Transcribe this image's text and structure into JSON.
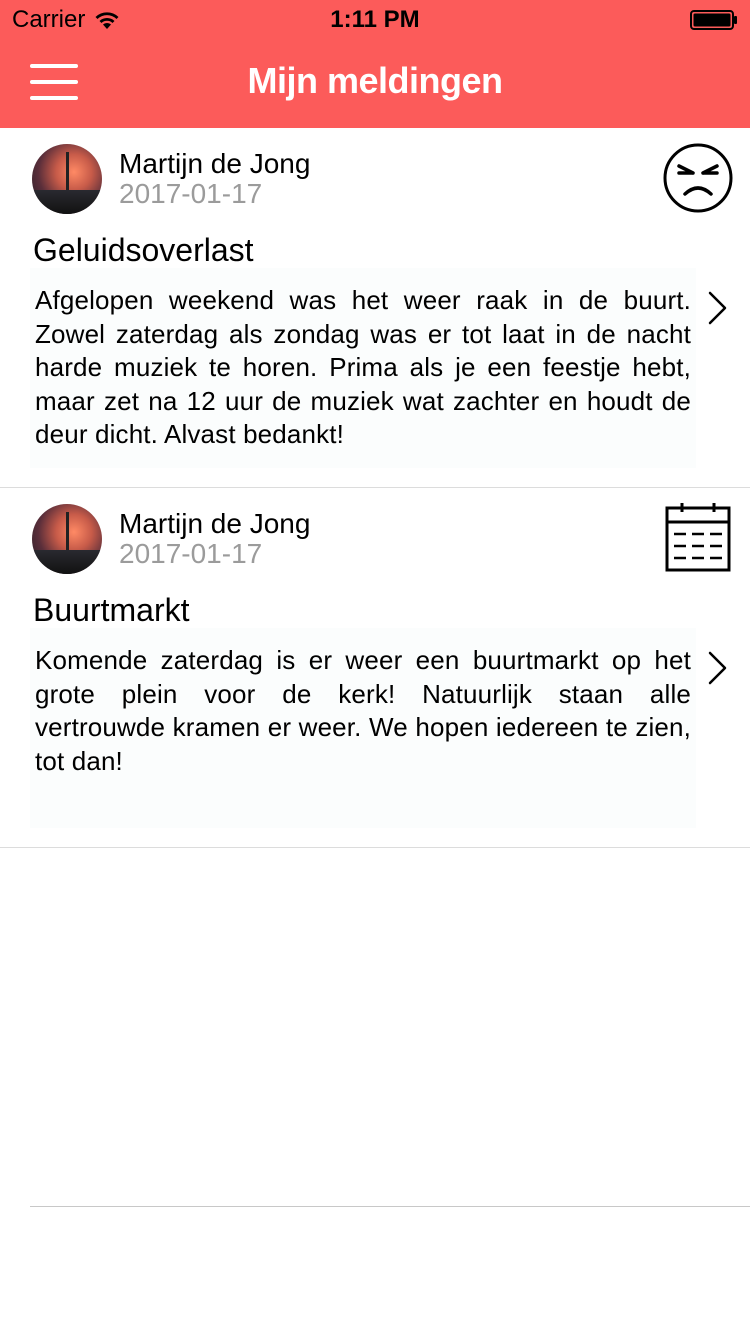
{
  "status_bar": {
    "carrier": "Carrier",
    "time": "1:11 PM",
    "wifi_icon": "wifi-icon",
    "battery_icon": "battery-icon"
  },
  "nav": {
    "title": "Mijn meldingen",
    "menu_icon": "hamburger-menu-icon",
    "background_color": "#fc5b5a",
    "title_color": "#ffffff"
  },
  "notifications": [
    {
      "author": "Martijn de Jong",
      "date": "2017-01-17",
      "title": "Geluidsoverlast",
      "body": "Afgelopen weekend was het weer raak in de buurt. Zowel zaterdag als zondag was er tot laat in de nacht harde muziek te horen. Prima als je een feestje hebt, maar zet na 12 uur de muziek wat zachter en houdt de deur dicht. Alvast bedankt!",
      "icon": "angry-face-icon"
    },
    {
      "author": "Martijn de Jong",
      "date": "2017-01-17",
      "title": "Buurtmarkt",
      "body": "Komende zaterdag is er weer een buurtmarkt op het grote plein voor de kerk! Natuurlijk staan alle vertrouwde kramen er weer. We hopen iedereen te zien, tot dan!",
      "icon": "calendar-icon"
    }
  ],
  "colors": {
    "date_text": "#9b9b9b",
    "divider": "#dcdcdc"
  }
}
